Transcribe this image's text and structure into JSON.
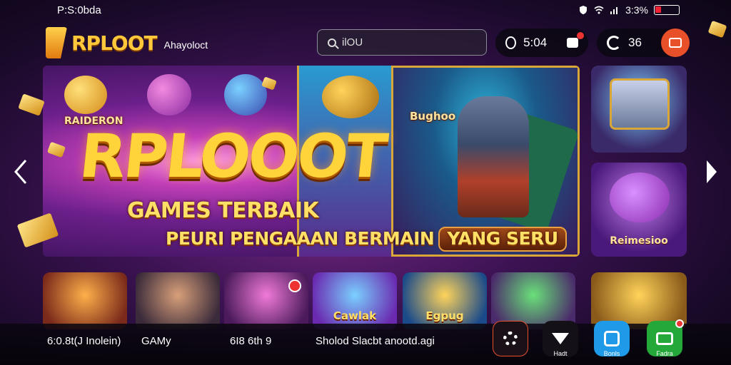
{
  "status": {
    "time": "P:S:0bda",
    "right_text": "3:3%"
  },
  "header": {
    "logo": "RPLOOT",
    "logo_sub": "Ahayoloct",
    "search_placeholder": "ilOU",
    "coins": "5:04",
    "refresh_count": "36"
  },
  "banner": {
    "title": "RPLOOOT",
    "subtitle1": "GAMES TERBAIK",
    "subtitle2_main": "PEURI PENGAAAN BERMAIN",
    "subtitle2_highlight": "YANG SERU",
    "label_left": "RAIDERON",
    "label_right": "Bughoo"
  },
  "side_cards": [
    {
      "label": ""
    },
    {
      "label": "Reimesioo"
    }
  ],
  "tiles": [
    {
      "caption": "",
      "color": "#c86a1a"
    },
    {
      "caption": "",
      "color": "#8a5a3a"
    },
    {
      "caption": "",
      "color": "#a83ab0"
    },
    {
      "caption": "Cawlak",
      "color": "#6a3ad0"
    },
    {
      "caption": "Egpug",
      "color": "#2a6ab0"
    },
    {
      "caption": "",
      "color": "#3a9a4a"
    },
    {
      "caption": "",
      "color": "#d89a2a"
    }
  ],
  "bottom": {
    "text1": "6:0.8t(J Inolein)",
    "text2": "GAMy",
    "text3": "6I8 6th 9",
    "text4": "Sholod Slacbt anootd.agi",
    "btn_captions": [
      "",
      "Hadt",
      "Bonls",
      "Fadra"
    ]
  },
  "colors": {
    "accent_orange": "#e8502a",
    "blue_button": "#1e9ae8",
    "green_button": "#24a83a",
    "gold": "#ffd43a"
  }
}
